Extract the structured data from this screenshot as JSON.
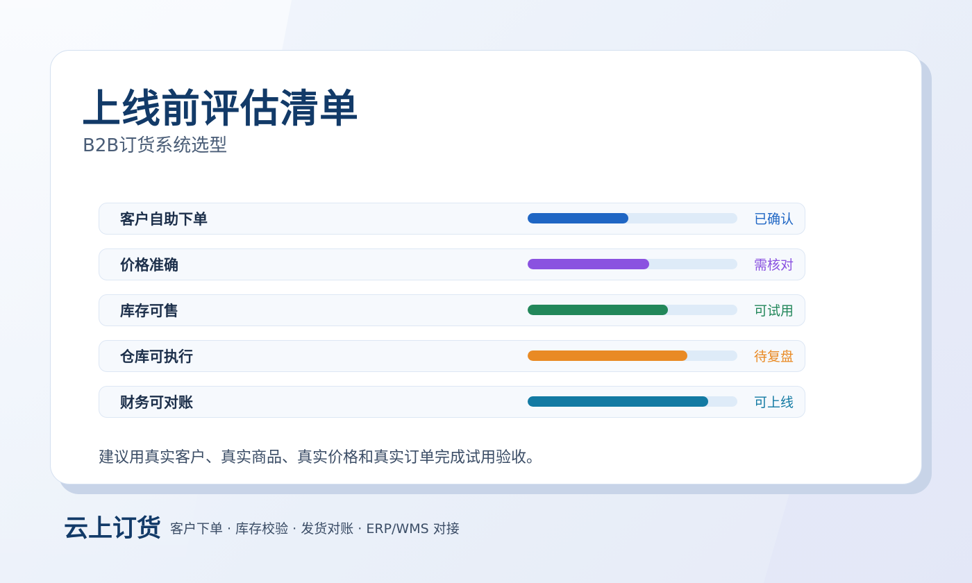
{
  "card": {
    "title": "上线前评估清单",
    "subtitle": "B2B订货系统选型",
    "note": "建议用真实客户、真实商品、真实价格和真实订单完成试用验收。"
  },
  "checklist": [
    {
      "label": "客户自助下单",
      "status": "已确认",
      "progress": 0.48,
      "color": "#1f66c4"
    },
    {
      "label": "价格准确",
      "status": "需核对",
      "progress": 0.58,
      "color": "#8a52e0"
    },
    {
      "label": "库存可售",
      "status": "可试用",
      "progress": 0.67,
      "color": "#22875a"
    },
    {
      "label": "仓库可执行",
      "status": "待复盘",
      "progress": 0.76,
      "color": "#e98a24"
    },
    {
      "label": "财务可对账",
      "status": "可上线",
      "progress": 0.86,
      "color": "#137aa3"
    }
  ],
  "footer": {
    "brand": "云上订货",
    "tagline": "客户下单 · 库存校验 · 发货对账 · ERP/WMS 对接"
  }
}
